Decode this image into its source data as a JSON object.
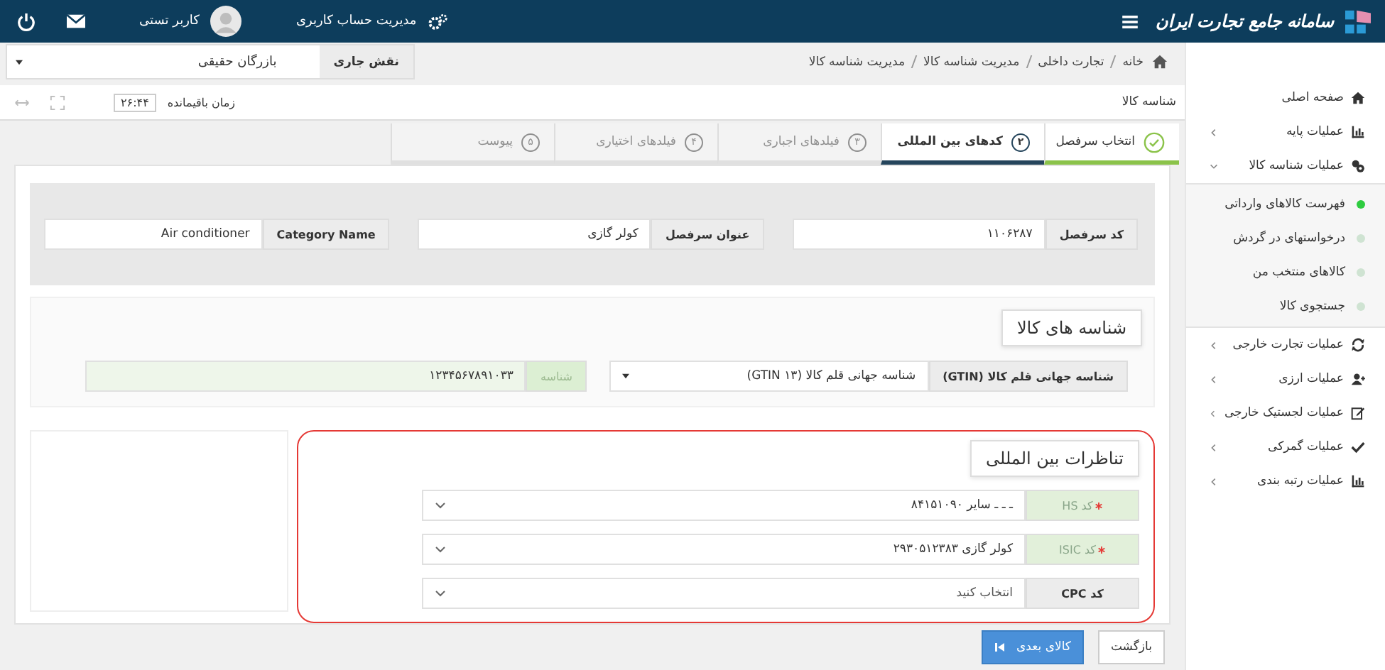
{
  "top_bar": {
    "logo_text": "سامانه جامع تجارت ایران",
    "account_link": "مدیریت حساب کاربری",
    "user_name": "کاربر تستی"
  },
  "sidebar": [
    {
      "label": "صفحه اصلی",
      "kind": "link"
    },
    {
      "label": "عملیات پایه",
      "kind": "group",
      "expanded": false
    },
    {
      "label": "عملیات شناسه کالا",
      "kind": "group",
      "expanded": true,
      "children": [
        {
          "label": "فهرست کالاهای وارداتی",
          "selected": true
        },
        {
          "label": "درخواستهای در گردش",
          "selected": false
        },
        {
          "label": "کالاهای منتخب من",
          "selected": false
        },
        {
          "label": "جستجوی کالا",
          "selected": false
        }
      ]
    },
    {
      "label": "عملیات تجارت خارجی",
      "kind": "group",
      "expanded": false
    },
    {
      "label": "عملیات ارزی",
      "kind": "group",
      "expanded": false
    },
    {
      "label": "عملیات لجستیک خارجی",
      "kind": "group",
      "expanded": false
    },
    {
      "label": "عملیات گمرکی",
      "kind": "group",
      "expanded": false
    },
    {
      "label": "عملیات رتبه بندی",
      "kind": "group",
      "expanded": false
    }
  ],
  "breadcrumb": [
    "خانه",
    "تجارت داخلی",
    "مدیریت شناسه کالا",
    "مدیریت شناسه کالا"
  ],
  "role": {
    "label": "نقش جاری",
    "value": "بازرگان حقیقی"
  },
  "page_title": "شناسه کالا",
  "timer": {
    "label": "زمان باقیمانده",
    "value": "۲۶:۴۴"
  },
  "steps": [
    {
      "label": "انتخاب سرفصل",
      "completed": true,
      "selected": false
    },
    {
      "number": "۲",
      "label": "کدهای بین المللی",
      "completed": false,
      "selected": true
    },
    {
      "number": "۳",
      "label": "فیلدهای اجباری",
      "completed": false,
      "selected": false
    },
    {
      "number": "۴",
      "label": "فیلدهای اختیاری",
      "completed": false,
      "selected": false
    },
    {
      "number": "۵",
      "label": "پیوست",
      "completed": false,
      "selected": false
    }
  ],
  "header_fields": [
    {
      "label": "کد سرفصل",
      "value": "۱۱۰۶۲۸۷"
    },
    {
      "label": "عنوان سرفصل",
      "value": "کولر گازی"
    },
    {
      "label": "Category Name",
      "value": "Air conditioner"
    }
  ],
  "identifiers": {
    "title": "شناسه های کالا",
    "type_select": {
      "label": "شناسه جهانی قلم کالا (GTIN)",
      "value": "شناسه جهانی قلم کالا (GTIN ۱۳)"
    },
    "id_field": {
      "label": "شناسه",
      "value": "۱۲۳۴۵۶۷۸۹۱۰۳۳",
      "readonly": true
    }
  },
  "mappings": {
    "title": "تناظرات بین المللی",
    "highlighted": true,
    "fields": [
      {
        "label": "کد HS",
        "required": true,
        "value": "ـ ـ ـ سایر ۸۴۱۵۱۰۹۰"
      },
      {
        "label": "کد ISIC",
        "required": true,
        "value": "کولر گازی ۲۹۳۰۵۱۲۳۸۳"
      },
      {
        "label": "کد CPC",
        "required": false,
        "placeholder": "انتخاب کنید"
      }
    ]
  },
  "buttons": [
    {
      "label": "بازگشت",
      "kind": "secondary"
    },
    {
      "label": "کالای بعدی",
      "kind": "primary"
    }
  ]
}
